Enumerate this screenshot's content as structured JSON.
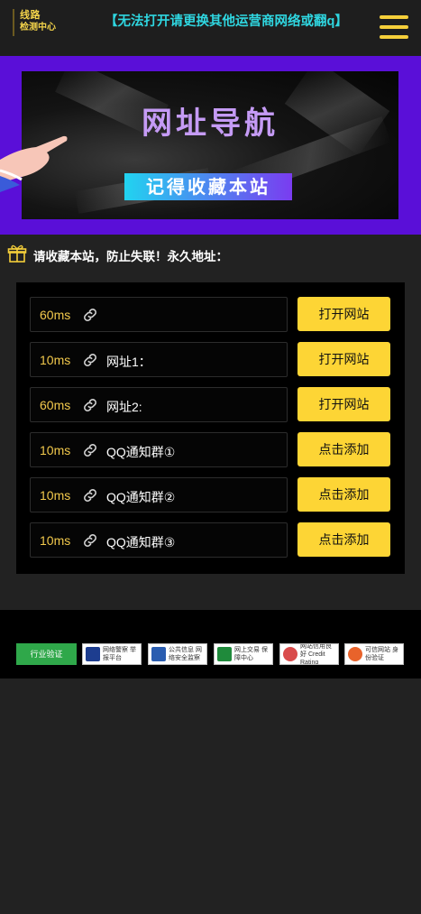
{
  "header": {
    "logo_line1": "线路",
    "logo_line2": "检测中心",
    "notice": "【无法打开请更换其他运营商网络或翻q】"
  },
  "banner": {
    "title": "网址导航",
    "subtitle": "记得收藏本站"
  },
  "tip": "请收藏本站，防止失联！永久地址：",
  "rows": [
    {
      "ms": "60ms",
      "label": "",
      "button": "打开网站"
    },
    {
      "ms": "10ms",
      "label": "网址1：",
      "button": "打开网站"
    },
    {
      "ms": "60ms",
      "label": "网址2:",
      "button": "打开网站"
    },
    {
      "ms": "10ms",
      "label": "QQ通知群①",
      "button": "点击添加"
    },
    {
      "ms": "10ms",
      "label": "QQ通知群②",
      "button": "点击添加"
    },
    {
      "ms": "10ms",
      "label": "QQ通知群③",
      "button": "点击添加"
    }
  ],
  "footer": {
    "badges": [
      {
        "text": "行业验证"
      },
      {
        "text": "网络警察 举报平台"
      },
      {
        "text": "公共信息 网络安全监察"
      },
      {
        "text": "网上交易 保障中心"
      },
      {
        "text": "网站信用良好 Credit Rating"
      },
      {
        "text": "可信网站 身份验证"
      }
    ]
  },
  "colors": {
    "accent_yellow": "#fdd535",
    "notice_cyan": "#2fd6e0",
    "banner_purple": "#5a0fd8",
    "latency_gold": "#f2c94c"
  },
  "icons": [
    "menu-icon",
    "gift-icon",
    "link-icon",
    "hand-icon"
  ]
}
